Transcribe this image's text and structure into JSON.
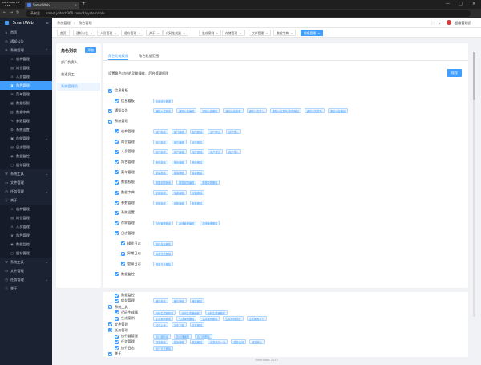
{
  "browser": {
    "sysinfo": "3ds 1 4064 TLF ... 7.45",
    "tab_title": "SmartWeb",
    "new_tab": "+",
    "security": "不安全",
    "url": "smart.joitech360.com/#/system/role",
    "win_min": "—",
    "win_max": "□",
    "win_close": "×"
  },
  "sidebar": {
    "brand": "SmartWeb",
    "items": [
      {
        "label": "首页",
        "icon": "⌂",
        "sub": false,
        "active": false,
        "arrow": ""
      },
      {
        "label": "通知公告",
        "icon": "◎",
        "sub": false,
        "active": false,
        "arrow": ""
      },
      {
        "label": "系统管理",
        "icon": "⚙",
        "sub": false,
        "active": false,
        "arrow": "⌃"
      },
      {
        "label": "机构管理",
        "icon": "♙",
        "sub": true,
        "active": false,
        "arrow": ""
      },
      {
        "label": "岗位管理",
        "icon": "▤",
        "sub": true,
        "active": false,
        "arrow": ""
      },
      {
        "label": "人员管理",
        "icon": "♙",
        "sub": true,
        "active": false,
        "arrow": ""
      },
      {
        "label": "角色管理",
        "icon": "♛",
        "sub": true,
        "active": true,
        "arrow": ""
      },
      {
        "label": "菜单管理",
        "icon": "≡",
        "sub": true,
        "active": false,
        "arrow": ""
      },
      {
        "label": "数据权限",
        "icon": "▦",
        "sub": true,
        "active": false,
        "arrow": ""
      },
      {
        "label": "数据字典",
        "icon": "▥",
        "sub": true,
        "active": false,
        "arrow": ""
      },
      {
        "label": "参数管理",
        "icon": "✎",
        "sub": true,
        "active": false,
        "arrow": ""
      },
      {
        "label": "系统设置",
        "icon": "⚙",
        "sub": true,
        "active": false,
        "arrow": ""
      },
      {
        "label": "存储管理",
        "icon": "▣",
        "sub": true,
        "active": false,
        "arrow": "⌄"
      },
      {
        "label": "日志管理",
        "icon": "▤",
        "sub": true,
        "active": false,
        "arrow": "⌄"
      },
      {
        "label": "数据监控",
        "icon": "◉",
        "sub": true,
        "active": false,
        "arrow": ""
      },
      {
        "label": "缓存管理",
        "icon": "▢",
        "sub": true,
        "active": false,
        "arrow": ""
      },
      {
        "label": "系统工具",
        "icon": "⚒",
        "sub": false,
        "active": false,
        "arrow": "⌄"
      },
      {
        "label": "文件管理",
        "icon": "▭",
        "sub": false,
        "active": false,
        "arrow": ""
      },
      {
        "label": "任务管理",
        "icon": "◷",
        "sub": false,
        "active": false,
        "arrow": "⌄"
      },
      {
        "label": "关于",
        "icon": "ⓘ",
        "sub": false,
        "active": false,
        "arrow": ""
      },
      {
        "label": "机构管理",
        "icon": "♙",
        "sub": true,
        "active": false,
        "arrow": ""
      },
      {
        "label": "岗位管理",
        "icon": "▤",
        "sub": true,
        "active": false,
        "arrow": ""
      },
      {
        "label": "人员管理",
        "icon": "♙",
        "sub": true,
        "active": false,
        "arrow": ""
      },
      {
        "label": "角色管理",
        "icon": "♛",
        "sub": true,
        "active": false,
        "arrow": ""
      },
      {
        "label": "数据监控",
        "icon": "◉",
        "sub": true,
        "active": false,
        "arrow": ""
      },
      {
        "label": "缓存管理",
        "icon": "▢",
        "sub": true,
        "active": false,
        "arrow": ""
      },
      {
        "label": "系统工具",
        "icon": "⚒",
        "sub": false,
        "active": false,
        "arrow": "⌄"
      },
      {
        "label": "文件管理",
        "icon": "▭",
        "sub": false,
        "active": false,
        "arrow": ""
      },
      {
        "label": "任务管理",
        "icon": "◷",
        "sub": false,
        "active": false,
        "arrow": "⌄"
      },
      {
        "label": "关于",
        "icon": "ⓘ",
        "sub": false,
        "active": false,
        "arrow": ""
      }
    ]
  },
  "header": {
    "breadcrumb": [
      "系统管理",
      "角色管理"
    ],
    "user_name": "超级管理员"
  },
  "tags": [
    {
      "label": "首页",
      "on": false
    },
    {
      "label": "通知公告",
      "on": false
    },
    {
      "label": "人员管理",
      "on": false
    },
    {
      "label": "缓存管理",
      "on": false
    },
    {
      "label": "关于",
      "on": false
    },
    {
      "label": "代码生成器",
      "on": false
    },
    {
      "label": "生成案例",
      "on": false
    },
    {
      "label": "存储管理",
      "on": false
    },
    {
      "label": "文件管理",
      "on": false
    },
    {
      "label": "数据字典",
      "on": false
    },
    {
      "label": "角色管理",
      "on": true
    }
  ],
  "roles": {
    "title": "角色列表",
    "add_label": "添加",
    "items": [
      {
        "label": "部门负责人",
        "selected": false
      },
      {
        "label": "普通员工",
        "selected": false
      },
      {
        "label": "系统管理员",
        "selected": true
      }
    ]
  },
  "panel": {
    "tabs": [
      {
        "label": "角色功能权限",
        "on": true
      },
      {
        "label": "角色数据范围",
        "on": false
      }
    ],
    "description": "设置角色对应的功能操作、后台管理权限",
    "save_label": "保存"
  },
  "permissions": [
    {
      "level": 0,
      "name": "信息看板",
      "buttons": []
    },
    {
      "level": 1,
      "name": "信息看板",
      "buttons": [
        "查看统计数据"
      ]
    },
    {
      "level": 0,
      "name": "通知公告",
      "buttons": [
        "通知公告新增",
        "通知公告编辑",
        "通知公告删除",
        "通知公告查看",
        "通知公告导入",
        "通知公告发布/发布撤回",
        "通知公告发布",
        "通知公告撤回"
      ]
    },
    {
      "level": 0,
      "name": "系统管理",
      "buttons": []
    },
    {
      "level": 1,
      "name": "机构管理",
      "buttons": [
        "部门新增",
        "部门编辑",
        "部门删除",
        "部门导出",
        "部门导入"
      ]
    },
    {
      "level": 1,
      "name": "岗位管理",
      "buttons": [
        "岗位新增",
        "岗位编辑",
        "岗位删除"
      ]
    },
    {
      "level": 1,
      "name": "人员管理",
      "buttons": [
        "用户新增",
        "用户编辑",
        "用户删除",
        "用户导出",
        "用户导入"
      ]
    },
    {
      "level": 1,
      "name": "角色管理",
      "buttons": [
        "角色新增",
        "角色编辑",
        "角色删除"
      ]
    },
    {
      "level": 1,
      "name": "菜单管理",
      "buttons": [
        "菜单新增",
        "菜单编辑",
        "菜单删除"
      ]
    },
    {
      "level": 1,
      "name": "数据权限",
      "buttons": [
        "数据权限新增",
        "数据权限编辑",
        "数据权限删除"
      ]
    },
    {
      "level": 1,
      "name": "数据字典",
      "buttons": [
        "字典新增",
        "字典编辑",
        "字典删除"
      ]
    },
    {
      "level": 1,
      "name": "参数管理",
      "buttons": [
        "参数新增",
        "参数编辑",
        "参数删除"
      ]
    },
    {
      "level": 1,
      "name": "系统设置",
      "buttons": []
    },
    {
      "level": 1,
      "name": "存储管理",
      "buttons": [
        "存储管理新增",
        "存储管理编辑",
        "存储管理删除"
      ]
    },
    {
      "level": 1,
      "name": "日志管理",
      "buttons": []
    },
    {
      "level": 2,
      "name": "操作日志",
      "buttons": [
        "操作日志删除"
      ]
    },
    {
      "level": 2,
      "name": "异常日志",
      "buttons": [
        "异常日志删除"
      ]
    },
    {
      "level": 2,
      "name": "登录日志",
      "buttons": [
        "登录日志删除"
      ]
    },
    {
      "level": 1,
      "name": "数据监控",
      "buttons": []
    }
  ],
  "permissions2": [
    {
      "level": 1,
      "name": "数据监控",
      "buttons": []
    },
    {
      "level": 1,
      "name": "缓存管理",
      "buttons": [
        "缓存新增",
        "缓存编辑",
        "缓存删除"
      ]
    },
    {
      "level": 0,
      "name": "系统工具",
      "buttons": []
    },
    {
      "level": 1,
      "name": "代码生成器",
      "buttons": [
        "代码生成器新增",
        "代码生成器编辑",
        "代码生成器删除"
      ]
    },
    {
      "level": 1,
      "name": "生成案例",
      "buttons": [
        "生成案例新增",
        "生成案例编辑",
        "生成案例删除",
        "生成案例导出",
        "生成案例导入"
      ]
    },
    {
      "level": 0,
      "name": "文件管理",
      "buttons": [
        "文件上传",
        "文件下载",
        "文件删除"
      ]
    },
    {
      "level": 0,
      "name": "任务管理",
      "buttons": []
    },
    {
      "level": 1,
      "name": "执行器管理",
      "buttons": [
        "执行器新增",
        "执行器编辑",
        "执行器删除"
      ]
    },
    {
      "level": 1,
      "name": "任务管理",
      "buttons": [
        "任务新增",
        "任务编辑",
        "任务删除",
        "任务执行一次",
        "任务启动",
        "任务停止"
      ]
    },
    {
      "level": 1,
      "name": "执行日志",
      "buttons": [
        "执行日志删除"
      ]
    },
    {
      "level": 0,
      "name": "关于",
      "buttons": []
    }
  ],
  "footer": "SmartWeb 2023"
}
